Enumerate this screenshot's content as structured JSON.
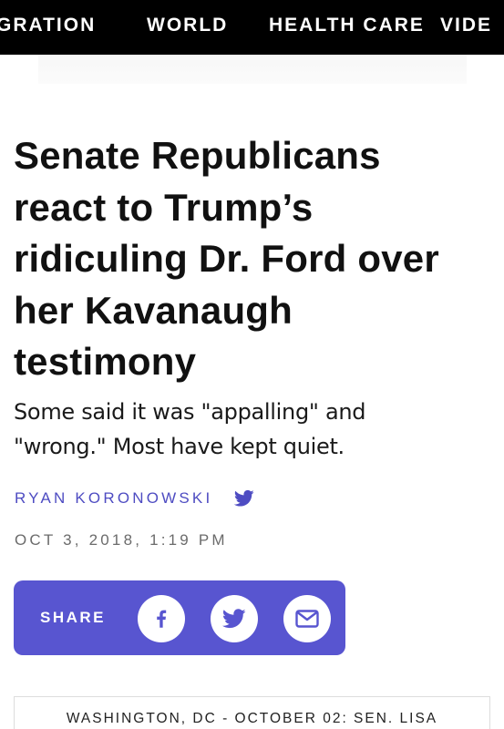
{
  "nav": {
    "items": [
      {
        "label": "GRATION"
      },
      {
        "label": "WORLD"
      },
      {
        "label": "HEALTH CARE"
      },
      {
        "label": "VIDE"
      }
    ]
  },
  "article": {
    "headline_lines": [
      "Senate Republicans",
      "react to Trump’s",
      "ridiculing Dr. Ford over",
      "her Kavanaugh",
      "testimony"
    ],
    "subhead_lines": [
      "Some said it was \"appalling\" and",
      "\"wrong.\" Most have kept quiet."
    ],
    "author": "RYAN KORONOWSKI",
    "author_social_icon": "twitter-bird-icon",
    "date": "OCT 3, 2018, 1:19 PM"
  },
  "share": {
    "label": "SHARE",
    "buttons": [
      {
        "icon": "facebook-icon"
      },
      {
        "icon": "twitter-icon"
      },
      {
        "icon": "email-icon"
      }
    ]
  },
  "photo_caption": "WASHINGTON, DC - OCTOBER 02: SEN. LISA",
  "colors": {
    "nav_bg": "#000000",
    "accent": "#5855d0",
    "author_link": "#4e4cc2",
    "date_text": "#6b6b6b"
  }
}
